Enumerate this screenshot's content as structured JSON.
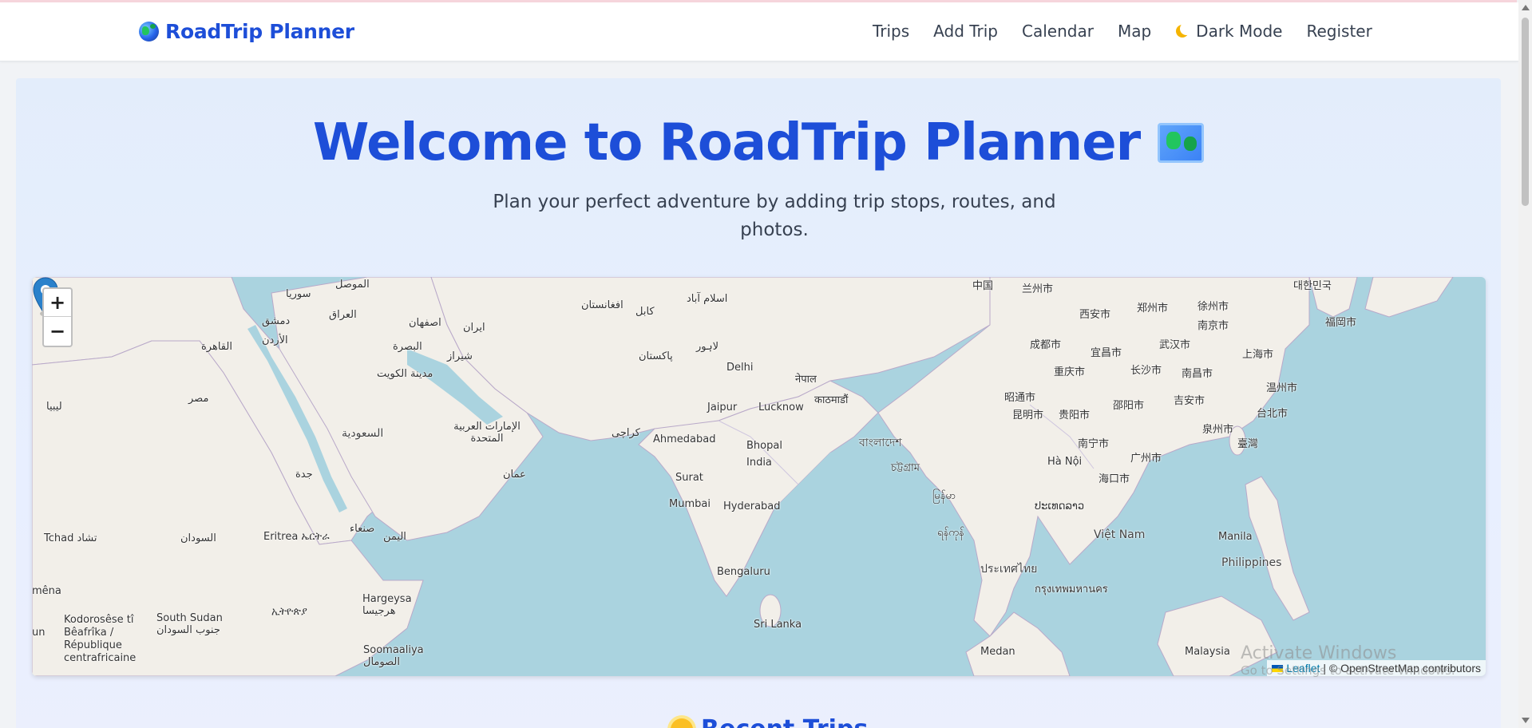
{
  "app": {
    "brand": "RoadTrip Planner"
  },
  "nav": {
    "trips": "Trips",
    "add_trip": "Add Trip",
    "calendar": "Calendar",
    "map": "Map",
    "dark_mode": "Dark Mode",
    "register": "Register"
  },
  "hero": {
    "title": "Welcome to RoadTrip Planner",
    "subtitle": "Plan your perfect adventure by adding trip stops, routes, and photos."
  },
  "map": {
    "zoom_in": "+",
    "zoom_out": "−",
    "attribution_leaflet": "Leaflet",
    "attribution_rest": "| © OpenStreetMap contributors",
    "labels": [
      "الموصل",
      "سوريا",
      "العراق",
      "دمشق",
      "الأردن",
      "القاهرة",
      "مصر",
      "ليبيا",
      "اصفهان",
      "ایران",
      "البصرة",
      "شیراز",
      "مدينة الكويت",
      "السعودية",
      "الإمارات العربية المتحدة",
      "عمان",
      "جدة",
      "صنعاء",
      "اليمن",
      "Tchad تشاد",
      "السودان",
      "Eritrea ኤርትራ",
      "ኢትዮጵያ",
      "Hargeysa هرجيسا",
      "Soomaaliya الصومال",
      "South Sudan جنوب السودان",
      "Kodorosêse tî Bêafrîka / République centrafricaine",
      "mêna",
      "un",
      "افغانستان",
      "کابل",
      "اسلام آباد",
      "پاکستان",
      "لاہور",
      "کراچی",
      "Delhi",
      "Jaipur",
      "Lucknow",
      "नेपाल",
      "काठमाडौं",
      "Ahmedabad",
      "Bhopal",
      "India",
      "Surat",
      "Mumbai",
      "Hyderabad",
      "Bengaluru",
      "Sri Lanka",
      "বাংলাদেশ",
      "চট্টগ্রাম",
      "မြန်မာ",
      "ရန်ကုန်",
      "ประเทศไทย",
      "กรุงเทพมหานคร",
      "ປະເທດລາວ",
      "Việt Nam",
      "Hà Nội",
      "Medan",
      "Malaysia",
      "Manila",
      "Philippines",
      "中国",
      "兰州市",
      "西安市",
      "郑州市",
      "徐州市",
      "南京市",
      "成都市",
      "武汉市",
      "宜昌市",
      "重庆市",
      "长沙市",
      "南昌市",
      "上海市",
      "温州市",
      "吉安市",
      "贵阳市",
      "昆明市",
      "邵阳市",
      "泉州市",
      "台北市",
      "臺灣",
      "南宁市",
      "广州市",
      "海口市",
      "昭通市",
      "福岡市",
      "대한민국"
    ]
  },
  "watermark": {
    "line1": "Activate Windows",
    "line2": "Go to Settings to activate Windows."
  },
  "recent": {
    "heading": "Recent Trips"
  }
}
